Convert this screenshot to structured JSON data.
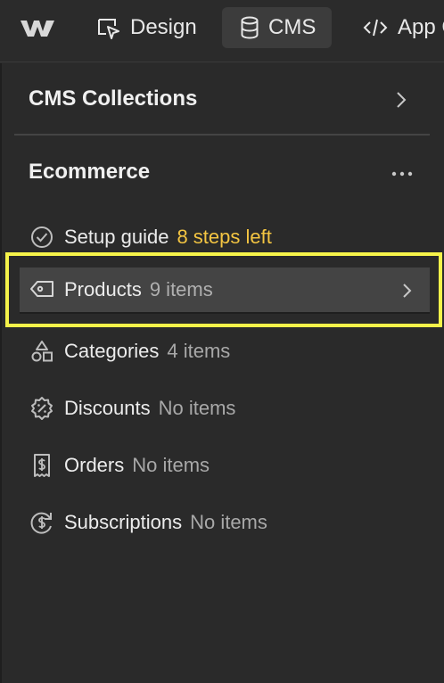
{
  "topbar": {
    "logo_icon": "webflow-logo-icon",
    "tabs": [
      {
        "label": "Design",
        "icon": "design-cursor-icon"
      },
      {
        "label": "CMS",
        "icon": "database-icon",
        "active": true
      },
      {
        "label": "App G",
        "icon": "code-icon"
      }
    ]
  },
  "collections": {
    "title": "CMS Collections",
    "icon": "chevron-right-icon"
  },
  "ecommerce": {
    "title": "Ecommerce",
    "more_icon": "more-dots-icon",
    "items": [
      {
        "label": "Setup guide",
        "meta": "8 steps left",
        "icon": "check-circle-icon"
      },
      {
        "label": "Products",
        "meta": "9 items",
        "icon": "tag-icon",
        "selected": true
      },
      {
        "label": "Categories",
        "meta": "4 items",
        "icon": "shapes-icon"
      },
      {
        "label": "Discounts",
        "meta": "No items",
        "icon": "percent-badge-icon"
      },
      {
        "label": "Orders",
        "meta": "No items",
        "icon": "receipt-icon"
      },
      {
        "label": "Subscriptions",
        "meta": "No items",
        "icon": "subscription-cycle-icon"
      }
    ]
  },
  "colors": {
    "background": "#2a2a2a",
    "accent": "#f4c542",
    "highlight": "#f6f34a"
  }
}
